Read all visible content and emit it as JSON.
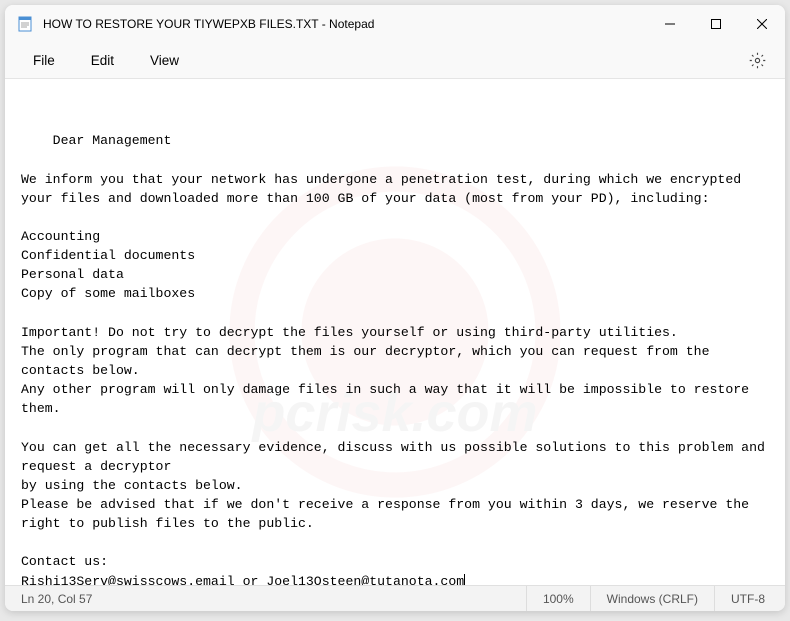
{
  "window": {
    "title": "HOW TO RESTORE YOUR TIYWEPXB FILES.TXT - Notepad"
  },
  "menu": {
    "file": "File",
    "edit": "Edit",
    "view": "View"
  },
  "content": {
    "text": "Dear Management\n\nWe inform you that your network has undergone a penetration test, during which we encrypted\nyour files and downloaded more than 100 GB of your data (most from your PD), including:\n\nAccounting\nConfidential documents\nPersonal data\nCopy of some mailboxes\n\nImportant! Do not try to decrypt the files yourself or using third-party utilities.\nThe only program that can decrypt them is our decryptor, which you can request from the contacts below.\nAny other program will only damage files in such a way that it will be impossible to restore them.\n\nYou can get all the necessary evidence, discuss with us possible solutions to this problem and request a decryptor\nby using the contacts below.\nPlease be advised that if we don't receive a response from you within 3 days, we reserve the right to publish files to the public.\n\nContact us:\nRishi13Serv@swisscows.email or Joel13Osteen@tutanota.com"
  },
  "statusbar": {
    "position": "Ln 20, Col 57",
    "zoom": "100%",
    "lineEnding": "Windows (CRLF)",
    "encoding": "UTF-8"
  }
}
